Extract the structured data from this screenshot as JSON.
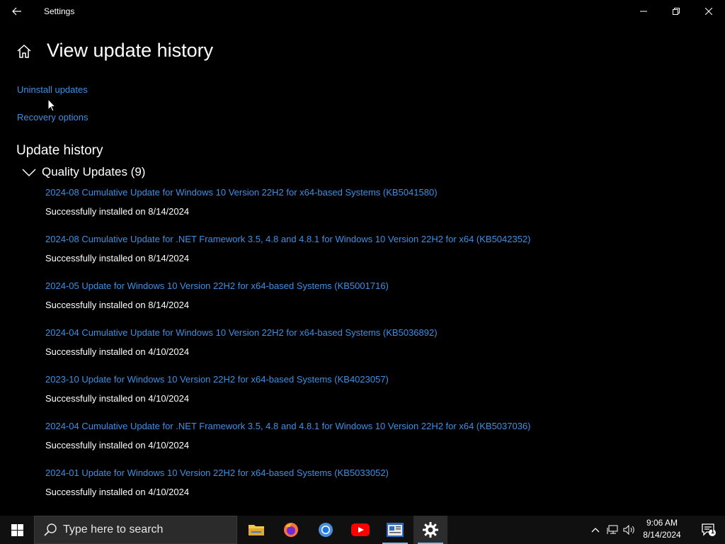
{
  "window": {
    "title": "Settings"
  },
  "page": {
    "title": "View update history"
  },
  "links": {
    "uninstall": "Uninstall updates",
    "recovery": "Recovery options"
  },
  "history": {
    "section_title": "Update history",
    "group_label": "Quality Updates (9)",
    "items": [
      {
        "title": "2024-08 Cumulative Update for Windows 10 Version 22H2 for x64-based Systems (KB5041580)",
        "status": "Successfully installed on 8/14/2024"
      },
      {
        "title": "2024-08 Cumulative Update for .NET Framework 3.5, 4.8 and 4.8.1 for Windows 10 Version 22H2 for x64 (KB5042352)",
        "status": "Successfully installed on 8/14/2024"
      },
      {
        "title": "2024-05 Update for Windows 10 Version 22H2 for x64-based Systems (KB5001716)",
        "status": "Successfully installed on 8/14/2024"
      },
      {
        "title": "2024-04 Cumulative Update for Windows 10 Version 22H2 for x64-based Systems (KB5036892)",
        "status": "Successfully installed on 4/10/2024"
      },
      {
        "title": "2023-10 Update for Windows 10 Version 22H2 for x64-based Systems (KB4023057)",
        "status": "Successfully installed on 4/10/2024"
      },
      {
        "title": "2024-04 Cumulative Update for .NET Framework 3.5, 4.8 and 4.8.1 for Windows 10 Version 22H2 for x64 (KB5037036)",
        "status": "Successfully installed on 4/10/2024"
      },
      {
        "title": "2024-01 Update for Windows 10 Version 22H2 for x64-based Systems (KB5033052)",
        "status": "Successfully installed on 4/10/2024"
      }
    ]
  },
  "taskbar": {
    "search_placeholder": "Type here to search",
    "apps": [
      "file-explorer",
      "firefox",
      "chrome",
      "youtube",
      "news",
      "settings"
    ],
    "active_app": "settings",
    "clock_time": "9:06 AM",
    "clock_date": "8/14/2024",
    "notification_count": "1"
  },
  "colors": {
    "link": "#3f8fe4",
    "background": "#000000",
    "taskbar": "#101010",
    "accent": "#76b9ed"
  }
}
